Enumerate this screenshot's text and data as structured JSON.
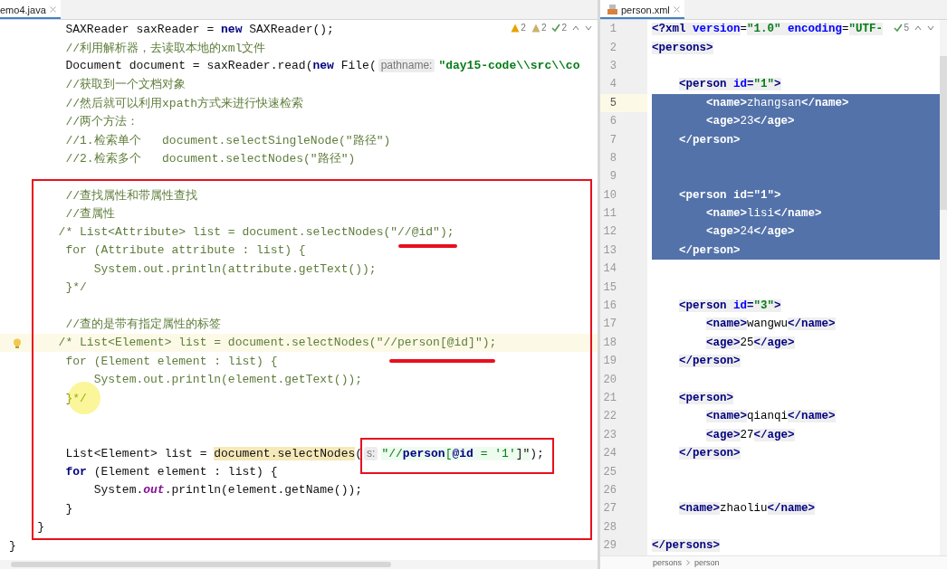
{
  "left_editor": {
    "tab": {
      "label": "emo4.java",
      "selected": true
    },
    "inspections": [
      {
        "kind": "warning",
        "count": "2"
      },
      {
        "kind": "weak",
        "count": "2"
      },
      {
        "kind": "typo",
        "count": "2"
      }
    ],
    "lines": [
      {
        "current": false,
        "tokens": [
          {
            "kind": "p",
            "text": "        SAXReader saxReader = "
          },
          {
            "kind": "k",
            "text": "new"
          },
          {
            "kind": "p",
            "text": " SAXReader();"
          }
        ]
      },
      {
        "current": false,
        "tokens": [
          {
            "kind": "c",
            "text": "        //利用解析器，去读取本地的xml文件"
          }
        ]
      },
      {
        "current": false,
        "tokens": [
          {
            "kind": "p",
            "text": "        Document document = saxReader.read("
          },
          {
            "kind": "k",
            "text": "new"
          },
          {
            "kind": "p",
            "text": " File("
          },
          {
            "kind": "h",
            "text": "pathname:"
          },
          {
            "kind": "s",
            "text": "\"day15-code\\\\src\\\\co"
          }
        ]
      },
      {
        "current": false,
        "tokens": [
          {
            "kind": "c",
            "text": "        //获取到一个文档对象"
          }
        ]
      },
      {
        "current": false,
        "tokens": [
          {
            "kind": "c",
            "text": "        //然后就可以利用xpath方式来进行快速检索"
          }
        ]
      },
      {
        "current": false,
        "tokens": [
          {
            "kind": "c",
            "text": "        //两个方法："
          }
        ]
      },
      {
        "current": false,
        "tokens": [
          {
            "kind": "c",
            "text": "        //1.检索单个   document.selectSingleNode(\"路径\")"
          }
        ]
      },
      {
        "current": false,
        "tokens": [
          {
            "kind": "c",
            "text": "        //2.检索多个   document.selectNodes(\"路径\")"
          }
        ]
      },
      {
        "current": false
      },
      {
        "current": false,
        "tokens": [
          {
            "kind": "c",
            "text": "        //查找属性和带属性查找"
          }
        ]
      },
      {
        "current": false,
        "tokens": [
          {
            "kind": "c",
            "text": "        //查属性"
          }
        ]
      },
      {
        "current": false,
        "tokens": [
          {
            "kind": "c",
            "text": "       /* List<Attribute> list = document.selectNodes(\"//@id\");"
          }
        ]
      },
      {
        "current": false,
        "tokens": [
          {
            "kind": "c",
            "text": "        for (Attribute attribute : list) {"
          }
        ]
      },
      {
        "current": false,
        "tokens": [
          {
            "kind": "c",
            "text": "            System.out.println(attribute.getText());"
          }
        ]
      },
      {
        "current": false,
        "tokens": [
          {
            "kind": "c",
            "text": "        }*/"
          }
        ]
      },
      {
        "current": false
      },
      {
        "current": false,
        "tokens": [
          {
            "kind": "c",
            "text": "        //查的是带有指定属性的标签"
          }
        ]
      },
      {
        "current": true,
        "tokens": [
          {
            "kind": "c",
            "text": "       /* List<Element> list = document.selectNodes(\"//person[@id]\");"
          }
        ]
      },
      {
        "current": false,
        "tokens": [
          {
            "kind": "c",
            "text": "        for (Element element : list) {"
          }
        ]
      },
      {
        "current": false,
        "tokens": [
          {
            "kind": "c",
            "text": "            System.out.println(element.getText());"
          }
        ]
      },
      {
        "current": false,
        "tokens": [
          {
            "kind": "c",
            "text": "        }*/"
          }
        ]
      },
      {
        "current": false
      },
      {
        "current": false
      },
      {
        "current": false,
        "tokens": [
          {
            "kind": "p",
            "text": "        List<Element> list = "
          },
          {
            "kind": "m",
            "text": "document.selectNodes"
          },
          {
            "kind": "p",
            "text": "("
          },
          {
            "kind": "h",
            "text": "s:"
          },
          {
            "kind": "xs",
            "text": "\"//"
          },
          {
            "kind": "xn",
            "text": "person"
          },
          {
            "kind": "xs",
            "text": "["
          },
          {
            "kind": "xn",
            "text": "@id"
          },
          {
            "kind": "xs",
            "text": " = '1'"
          },
          {
            "kind": "xp",
            "text": "]\""
          },
          {
            "kind": "p",
            "text": ");"
          }
        ]
      },
      {
        "current": false,
        "tokens": [
          {
            "kind": "k",
            "text": "        for"
          },
          {
            "kind": "p",
            "text": " (Element element : list) {"
          }
        ]
      },
      {
        "current": false,
        "tokens": [
          {
            "kind": "p",
            "text": "            System."
          },
          {
            "kind": "i",
            "text": "out"
          },
          {
            "kind": "p",
            "text": ".println(element.getName());"
          }
        ]
      },
      {
        "current": false,
        "tokens": [
          {
            "kind": "p",
            "text": "        }"
          }
        ]
      },
      {
        "current": false,
        "tokens": [
          {
            "kind": "p",
            "text": "    }"
          }
        ]
      },
      {
        "current": false,
        "tokens": [
          {
            "kind": "p",
            "text": "}"
          }
        ]
      }
    ]
  },
  "right_editor": {
    "tab": {
      "label": "person.xml",
      "selected": true
    },
    "inspections": [
      {
        "kind": "typo",
        "count": "5"
      }
    ],
    "lines": [
      {
        "number": "1",
        "selected": false,
        "current": false,
        "tokens": [
          {
            "kind": "t",
            "text": "<?xml"
          },
          {
            "kind": "a",
            "text": " version"
          },
          {
            "kind": "x",
            "text": "="
          },
          {
            "kind": "v",
            "text": "\"1.0\""
          },
          {
            "kind": "a",
            "text": " encoding"
          },
          {
            "kind": "x",
            "text": "="
          },
          {
            "kind": "v",
            "text": "\"UTF-"
          }
        ]
      },
      {
        "number": "2",
        "selected": false,
        "current": false,
        "tokens": [
          {
            "kind": "t",
            "text": "<persons>"
          }
        ]
      },
      {
        "number": "3",
        "selected": false,
        "current": false
      },
      {
        "number": "4",
        "selected": false,
        "current": false,
        "tokens": [
          {
            "kind": "t",
            "text": "    <person"
          },
          {
            "kind": "a",
            "text": " id"
          },
          {
            "kind": "t",
            "text": "="
          },
          {
            "kind": "v",
            "text": "\"1\""
          },
          {
            "kind": "t",
            "text": ">"
          }
        ]
      },
      {
        "number": "5",
        "selected": true,
        "current": true,
        "tokens": [
          {
            "kind": "t",
            "text": "        <name>"
          },
          {
            "kind": "x",
            "text": "zhangsan"
          },
          {
            "kind": "t",
            "text": "</name>"
          }
        ]
      },
      {
        "number": "6",
        "selected": true,
        "current": false,
        "tokens": [
          {
            "kind": "t",
            "text": "        <age>"
          },
          {
            "kind": "x",
            "text": "23"
          },
          {
            "kind": "t",
            "text": "</age>"
          }
        ]
      },
      {
        "number": "7",
        "selected": true,
        "current": false,
        "tokens": [
          {
            "kind": "t",
            "text": "    </person>"
          }
        ]
      },
      {
        "number": "8",
        "selected": true,
        "current": false
      },
      {
        "number": "9",
        "selected": true,
        "current": false
      },
      {
        "number": "10",
        "selected": true,
        "current": false,
        "tokens": [
          {
            "kind": "t",
            "text": "    <person"
          },
          {
            "kind": "a",
            "text": " id"
          },
          {
            "kind": "t",
            "text": "="
          },
          {
            "kind": "v",
            "text": "\"1\""
          },
          {
            "kind": "t",
            "text": ">"
          }
        ]
      },
      {
        "number": "11",
        "selected": true,
        "current": false,
        "tokens": [
          {
            "kind": "t",
            "text": "        <name>"
          },
          {
            "kind": "x",
            "text": "lisi"
          },
          {
            "kind": "t",
            "text": "</name>"
          }
        ]
      },
      {
        "number": "12",
        "selected": true,
        "current": false,
        "tokens": [
          {
            "kind": "t",
            "text": "        <age>"
          },
          {
            "kind": "x",
            "text": "24"
          },
          {
            "kind": "t",
            "text": "</age>"
          }
        ]
      },
      {
        "number": "13",
        "selected": true,
        "current": false,
        "tokens": [
          {
            "kind": "t",
            "text": "    </person>"
          }
        ]
      },
      {
        "number": "14",
        "selected": false,
        "current": false
      },
      {
        "number": "15",
        "selected": false,
        "current": false
      },
      {
        "number": "16",
        "selected": false,
        "current": false,
        "tokens": [
          {
            "kind": "t",
            "text": "    <person"
          },
          {
            "kind": "a",
            "text": " id"
          },
          {
            "kind": "t",
            "text": "="
          },
          {
            "kind": "v",
            "text": "\"3\""
          },
          {
            "kind": "t",
            "text": ">"
          }
        ]
      },
      {
        "number": "17",
        "selected": false,
        "current": false,
        "tokens": [
          {
            "kind": "t",
            "text": "        <name>"
          },
          {
            "kind": "x",
            "text": "wangwu"
          },
          {
            "kind": "t",
            "text": "</name>"
          }
        ]
      },
      {
        "number": "18",
        "selected": false,
        "current": false,
        "tokens": [
          {
            "kind": "t",
            "text": "        <age>"
          },
          {
            "kind": "x",
            "text": "25"
          },
          {
            "kind": "t",
            "text": "</age>"
          }
        ]
      },
      {
        "number": "19",
        "selected": false,
        "current": false,
        "tokens": [
          {
            "kind": "t",
            "text": "    </person>"
          }
        ]
      },
      {
        "number": "20",
        "selected": false,
        "current": false
      },
      {
        "number": "21",
        "selected": false,
        "current": false,
        "tokens": [
          {
            "kind": "t",
            "text": "    <person>"
          }
        ]
      },
      {
        "number": "22",
        "selected": false,
        "current": false,
        "tokens": [
          {
            "kind": "t",
            "text": "        <name>"
          },
          {
            "kind": "x",
            "text": "qianqi"
          },
          {
            "kind": "t",
            "text": "</name>"
          }
        ]
      },
      {
        "number": "23",
        "selected": false,
        "current": false,
        "tokens": [
          {
            "kind": "t",
            "text": "        <age>"
          },
          {
            "kind": "x",
            "text": "27"
          },
          {
            "kind": "t",
            "text": "</age>"
          }
        ]
      },
      {
        "number": "24",
        "selected": false,
        "current": false,
        "tokens": [
          {
            "kind": "t",
            "text": "    </person>"
          }
        ]
      },
      {
        "number": "25",
        "selected": false,
        "current": false
      },
      {
        "number": "26",
        "selected": false,
        "current": false
      },
      {
        "number": "27",
        "selected": false,
        "current": false,
        "tokens": [
          {
            "kind": "t",
            "text": "    <name>"
          },
          {
            "kind": "x",
            "text": "zhaoliu"
          },
          {
            "kind": "t",
            "text": "</name>"
          }
        ]
      },
      {
        "number": "28",
        "selected": false,
        "current": false
      },
      {
        "number": "29",
        "selected": false,
        "current": false,
        "tokens": [
          {
            "kind": "t",
            "text": "</persons>"
          }
        ]
      }
    ],
    "breadcrumbs": [
      "persons",
      "person"
    ]
  }
}
